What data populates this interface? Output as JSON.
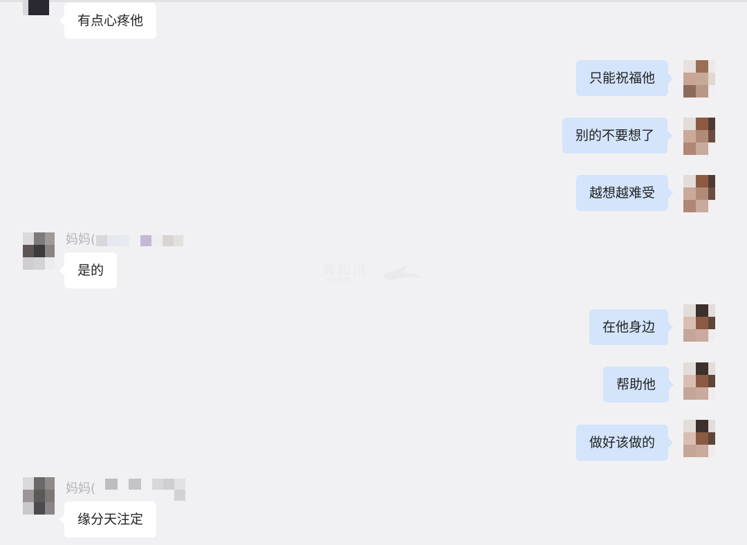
{
  "chat": {
    "messages": [
      {
        "side": "left",
        "text": "有点心疼他"
      },
      {
        "side": "right",
        "text": "只能祝福他"
      },
      {
        "side": "right",
        "text": "别的不要想了"
      },
      {
        "side": "right",
        "text": "越想越难受"
      },
      {
        "side": "left",
        "sender": "妈妈(",
        "text": "是的"
      },
      {
        "side": "right",
        "text": "在他身边"
      },
      {
        "side": "right",
        "text": "帮助他"
      },
      {
        "side": "right",
        "text": "做好该做的"
      },
      {
        "side": "left",
        "sender": "妈妈(",
        "text": "缘分天注定"
      }
    ]
  },
  "watermark": {
    "text": "海和讯",
    "sub": "Haiheb..."
  },
  "colors": {
    "background": "#f1f1f3",
    "left_bubble": "#ffffff",
    "right_bubble": "#d3e4fb",
    "text": "#222222",
    "sender_text": "#b4b4b8"
  },
  "icons": {
    "avatar": "pixelated-avatar-icon",
    "watermark_logo": "bird-logo-icon"
  }
}
